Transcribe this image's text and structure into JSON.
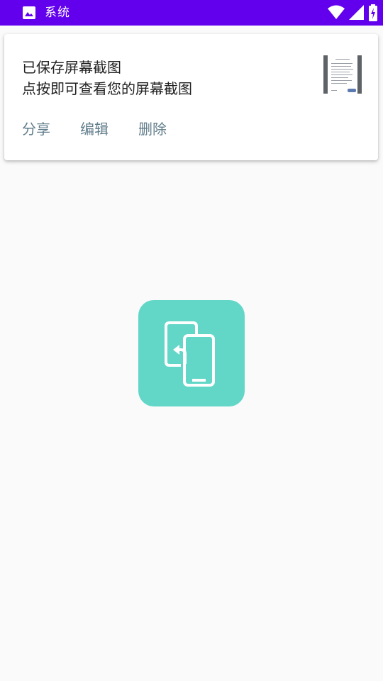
{
  "status_bar": {
    "app_title": "系统",
    "icons": [
      "image-icon",
      "wifi-icon",
      "signal-icon",
      "battery-icon"
    ],
    "background_color": "#6200ee"
  },
  "notification": {
    "title": "已保存屏幕截图",
    "text": "点按即可查看您的屏幕截图",
    "actions": [
      {
        "label": "分享"
      },
      {
        "label": "编辑"
      },
      {
        "label": "删除"
      }
    ],
    "action_color": "#607d8b"
  },
  "app_icon": {
    "icon": "phone-transfer-icon",
    "background_color": "#62d7c8"
  }
}
